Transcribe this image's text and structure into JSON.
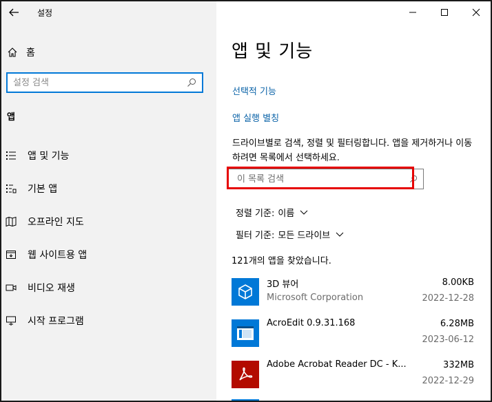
{
  "window": {
    "title": "설정"
  },
  "sidebar": {
    "home_label": "홈",
    "search_placeholder": "설정 검색",
    "section_label": "앱",
    "items": [
      {
        "label": "앱 및 기능",
        "icon": "apps-features-icon"
      },
      {
        "label": "기본 앱",
        "icon": "default-apps-icon"
      },
      {
        "label": "오프라인 지도",
        "icon": "offline-maps-icon"
      },
      {
        "label": "웹 사이트용 앱",
        "icon": "apps-for-websites-icon"
      },
      {
        "label": "비디오 재생",
        "icon": "video-playback-icon"
      },
      {
        "label": "시작 프로그램",
        "icon": "startup-icon"
      }
    ]
  },
  "main": {
    "title": "앱 및 기능",
    "links": [
      "선택적 기능",
      "앱 실행 별칭"
    ],
    "description": "드라이브별로 검색, 정렬 및 필터링합니다. 앱을 제거하거나 이동하려면 목록에서 선택하세요.",
    "list_search_placeholder": "이 목록 검색",
    "sort": {
      "label": "정렬 기준:",
      "value": "이름"
    },
    "filter": {
      "label": "필터 기준:",
      "value": "모든 드라이브"
    },
    "count_text": "121개의 앱을 찾았습니다.",
    "apps": [
      {
        "name": "3D 뷰어",
        "publisher": "Microsoft Corporation",
        "size": "8.00KB",
        "date": "2022-12-28",
        "icon": "3d-viewer-icon"
      },
      {
        "name": "AcroEdit 0.9.31.168",
        "publisher": "",
        "size": "6.28MB",
        "date": "2023-06-12",
        "icon": "acroedit-icon"
      },
      {
        "name": "Adobe Acrobat Reader DC - K...",
        "publisher": "",
        "size": "332MB",
        "date": "2022-12-29",
        "icon": "adobe-acrobat-icon"
      }
    ]
  },
  "colors": {
    "accent": "#0078d7",
    "link": "#0b63a8",
    "highlight": "#e60000",
    "sidebar_bg": "#f2f2f2"
  }
}
